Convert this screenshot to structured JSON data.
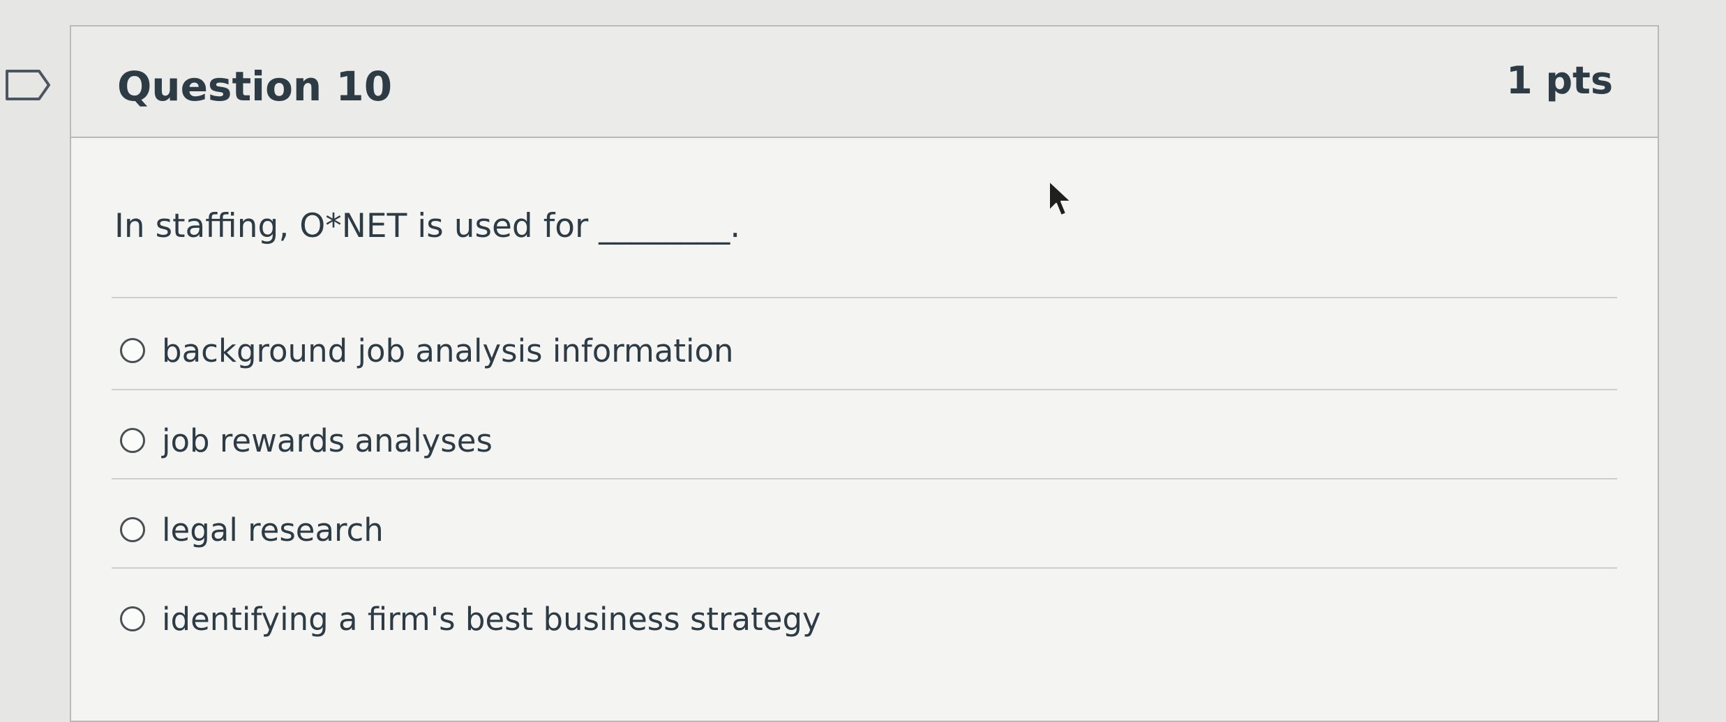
{
  "question": {
    "title": "Question 10",
    "points": "1 pts",
    "text": "In staffing, O*NET is used for ________.",
    "answers": [
      {
        "label": "background job analysis information",
        "selected": false
      },
      {
        "label": "job rewards analyses",
        "selected": false
      },
      {
        "label": "legal research",
        "selected": false
      },
      {
        "label": "identifying a firm's best business strategy",
        "selected": false
      }
    ]
  },
  "icons": {
    "flag": "flag-question-icon",
    "cursor": "mouse-pointer-icon"
  },
  "colors": {
    "text": "#2d3b45",
    "border": "#b9b9b7",
    "header_bg": "#ebebe9",
    "card_bg": "#f4f4f2"
  }
}
